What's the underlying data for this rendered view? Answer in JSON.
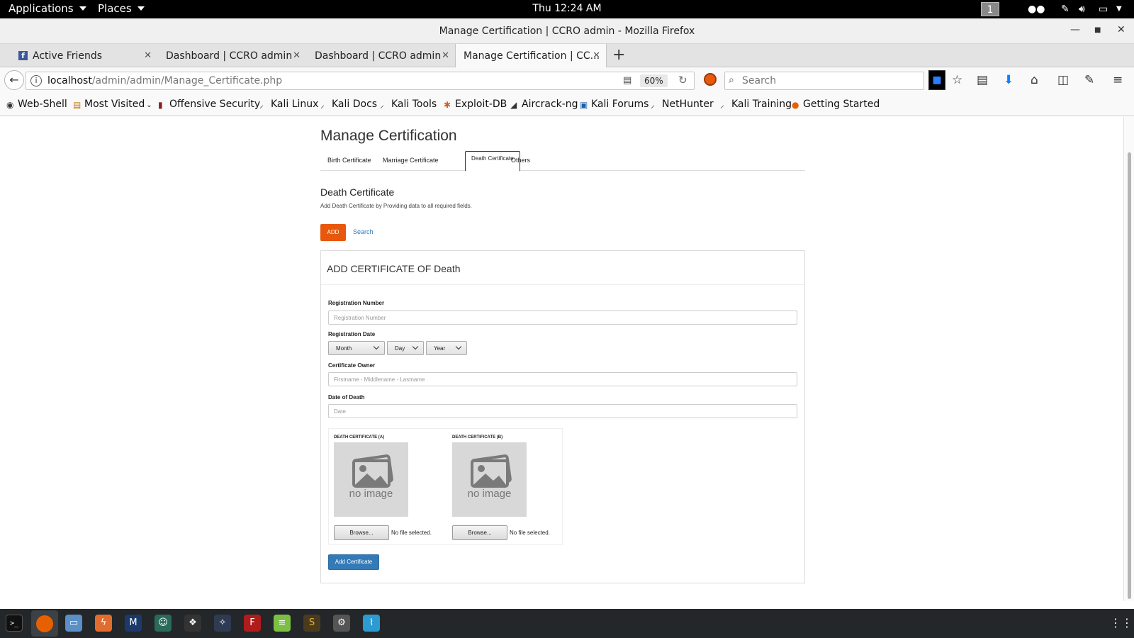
{
  "topbar": {
    "applications": "Applications",
    "places": "Places",
    "clock": "Thu 12:24 AM",
    "workspace": "1"
  },
  "window": {
    "title": "Manage Certification | CCRO admin - Mozilla Firefox"
  },
  "tabs": [
    {
      "label": "Active Friends"
    },
    {
      "label": "Dashboard | CCRO admin"
    },
    {
      "label": "Dashboard | CCRO admin"
    },
    {
      "label": "Manage Certification | CC..."
    }
  ],
  "navbar": {
    "url_host": "localhost",
    "url_path": "/admin/admin/Manage_Certificate.php",
    "zoom": "60%",
    "search_placeholder": "Search"
  },
  "bookmarks": [
    "Web-Shell",
    "Most Visited",
    "Offensive Security",
    "Kali Linux",
    "Kali Docs",
    "Kali Tools",
    "Exploit-DB",
    "Aircrack-ng",
    "Kali Forums",
    "NetHunter",
    "Kali Training",
    "Getting Started"
  ],
  "page": {
    "title": "Manage Certification",
    "tabs": [
      "Birth Certificate",
      "Marriage Certificate",
      "Death Certificate",
      "Others"
    ],
    "active_tab": "Death Certificate",
    "section_title": "Death Certificate",
    "section_subtitle": "Add Death Certificate by Providing data to all required fields.",
    "add_button": "ADD",
    "search_link": "Search",
    "panel_title": "ADD CERTIFICATE OF Death",
    "form": {
      "reg_number_label": "Registration Number",
      "reg_number_placeholder": "Registration Number",
      "reg_date_label": "Registration Date",
      "month": "Month",
      "day": "Day",
      "year": "Year",
      "owner_label": "Certificate Owner",
      "owner_placeholder": "Firstname - Middlename - Lastname",
      "death_date_label": "Date of Death",
      "death_date_placeholder": "Date",
      "cert_a_label": "DEATH CERTIFICATE (A)",
      "cert_b_label": "DEATH CERTIFICATE (B)",
      "no_image": "no image",
      "browse": "Browse...",
      "no_file": "No file selected.",
      "submit": "Add Certificate"
    }
  },
  "colors": {
    "accent_orange": "#e8580c",
    "primary_blue": "#337ab7"
  }
}
